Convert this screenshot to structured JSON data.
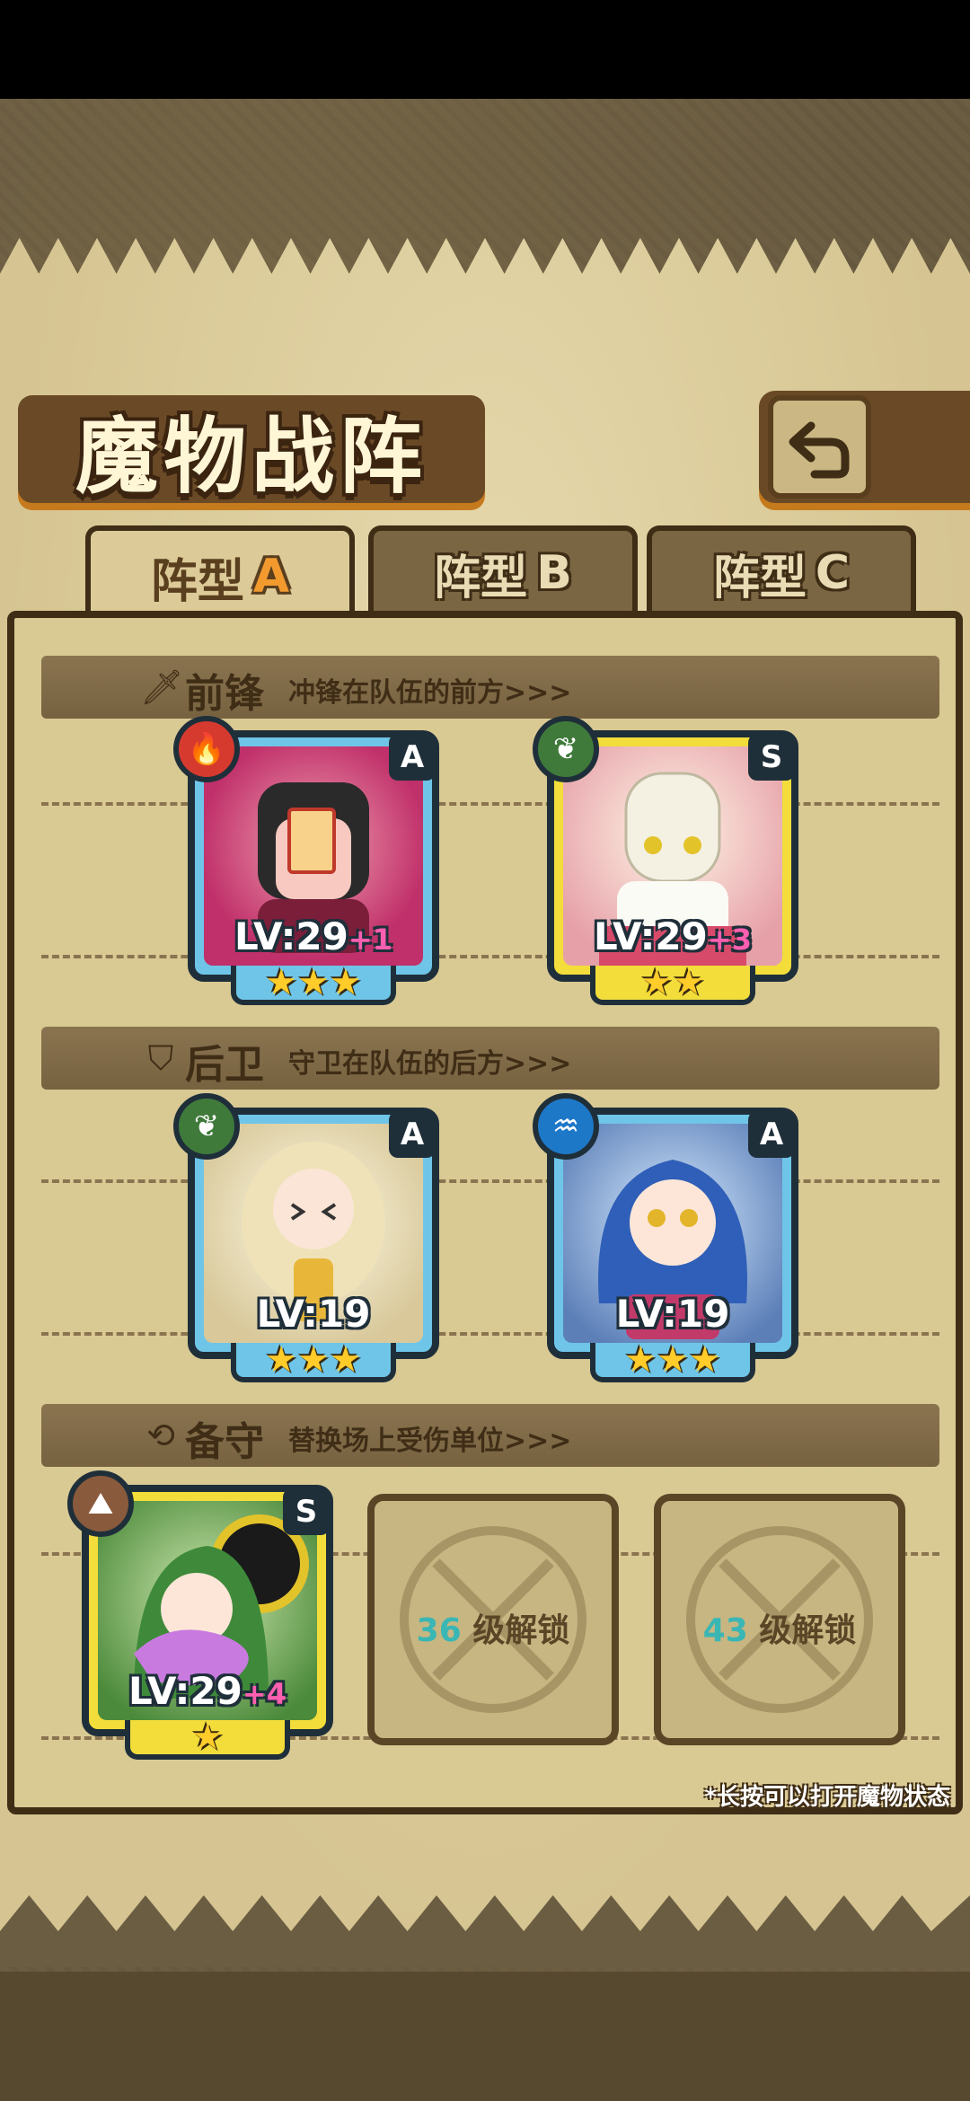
{
  "header": {
    "title": "魔物战阵",
    "back_icon": "back-arrow-icon"
  },
  "tabs": [
    {
      "label": "阵型",
      "suffix": "A",
      "active": true
    },
    {
      "label": "阵型",
      "suffix": "B",
      "active": false
    },
    {
      "label": "阵型",
      "suffix": "C",
      "active": false
    }
  ],
  "sections": {
    "front": {
      "name": "前锋",
      "desc": "冲锋在队伍的前方>>>",
      "icon": "sword-icon"
    },
    "rear": {
      "name": "后卫",
      "desc": "守卫在队伍的后方>>>",
      "icon": "shield-icon"
    },
    "reserve": {
      "name": "备守",
      "desc": "替换场上受伤单位>>>",
      "icon": "swap-icon"
    }
  },
  "cards": {
    "front_1": {
      "level": "LV:29",
      "bonus": "+1",
      "rank": "A",
      "element": "fire-icon",
      "stars": "★★★",
      "element_color": "#d63a2f"
    },
    "front_2": {
      "level": "LV:29",
      "bonus": "+3",
      "rank": "S",
      "element": "leaf-icon",
      "stars": "★★",
      "element_color": "#3f7a3a"
    },
    "rear_1": {
      "level": "LV:19",
      "bonus": "",
      "rank": "A",
      "element": "leaf-icon",
      "stars": "★★★",
      "element_color": "#3f7a3a"
    },
    "rear_2": {
      "level": "LV:19",
      "bonus": "",
      "rank": "A",
      "element": "water-icon",
      "stars": "★★★",
      "element_color": "#1e78c8"
    },
    "reserve_1": {
      "level": "LV:29",
      "bonus": "+4",
      "rank": "S",
      "element": "earth-icon",
      "stars": "★",
      "element_color": "#8a5a3c"
    }
  },
  "locked": [
    {
      "level": "36",
      "text": "级解锁"
    },
    {
      "level": "43",
      "text": "级解锁"
    }
  ],
  "hint": "*长按可以打开魔物状态"
}
